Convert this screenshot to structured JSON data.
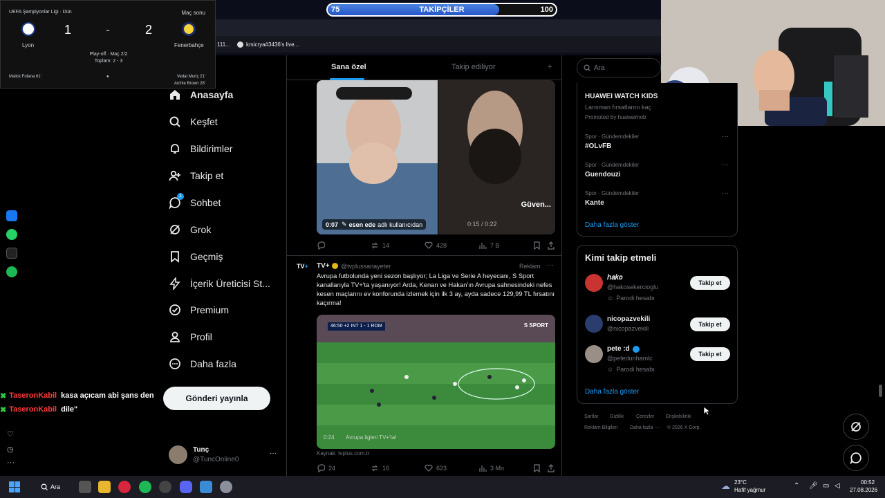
{
  "colors": {
    "accent": "#1d9bf0",
    "brand_red": "#e0245e",
    "bar_fill": "#2f66d6"
  },
  "stream": {
    "follower_bar": {
      "label": "TAKİPÇİLER",
      "current": "75",
      "goal": "100",
      "progress_fraction": 0.75
    },
    "scoreboard": {
      "competition": "UEFA Şampiyonlar Ligi · Dün",
      "status": "Maç sonu",
      "home_team": "Lyon",
      "away_team": "Fenerbahçe",
      "home_score": "1",
      "away_score": "2",
      "dash": "-",
      "round": "Play-off · Maç 2/2",
      "aggregate": "Toplam: 2 - 3",
      "home_scorer": "Malick Fofana 61'",
      "away_scorer_1": "Vedat Muriç 21'",
      "away_scorer_2": "Archie Brown 28'"
    },
    "browser_tabs": [
      "111...",
      "krsicrya#3436's live..."
    ],
    "chat": [
      {
        "user": "TaseronKabil",
        "message": "kasa açıcam abi şans den"
      },
      {
        "user": "TaseronKabil",
        "message": "dile\""
      }
    ]
  },
  "nav": {
    "items": [
      {
        "label": "Anasayfa",
        "icon": "home-icon"
      },
      {
        "label": "Keşfet",
        "icon": "search-icon"
      },
      {
        "label": "Bildirimler",
        "icon": "bell-icon"
      },
      {
        "label": "Takip et",
        "icon": "person-add-icon"
      },
      {
        "label": "Sohbet",
        "icon": "chat-icon",
        "badge": "1"
      },
      {
        "label": "Grok",
        "icon": "grok-icon"
      },
      {
        "label": "Geçmiş",
        "icon": "bookmark-icon"
      },
      {
        "label": "İçerik Üreticisi St...",
        "icon": "bolt-icon"
      },
      {
        "label": "Premium",
        "icon": "premium-icon"
      },
      {
        "label": "Profil",
        "icon": "person-icon"
      },
      {
        "label": "Daha fazla",
        "icon": "more-circle-icon"
      }
    ],
    "post_button": "Gönderi yayınla",
    "account": {
      "name": "Tunç",
      "handle": "@TuncOnline0",
      "more": "···"
    }
  },
  "feed": {
    "tabs": {
      "for_you": "Sana özel",
      "following": "Takip ediliyor",
      "add": "+"
    },
    "post1": {
      "video_time": "0:07",
      "caption_user": "esen ede",
      "caption_rest": "adlı kullanıcıdan",
      "video_time_right": "0:15 / 0:22",
      "overlay_text": "Güven...",
      "replies": "",
      "retweets": "14",
      "likes": "428",
      "views": "7 B"
    },
    "post2": {
      "author": "TV+",
      "handle": "@tvplussanayeter",
      "ad_label": "Reklam",
      "more": "···",
      "text": "Avrupa futbolunda yeni sezon başlıyor; La Liga ve Serie A heyecanı, S Sport kanallarıyla TV+'ta yaşanıyor! Arda, Kenan ve Hakan'ın Avrupa sahnesindeki nefes kesen maçlarını ev konforunda izlemek için ilk 3 ay, ayda sadece 129,99 TL fırsatını kaçırma!",
      "video_scoreboard": "46:50  +2  INT  1 - 1  ROM",
      "video_brand": "S SPORT",
      "video_time": "0:24",
      "video_caption": "Avrupa ligleri TV+'ta!",
      "source": "Kaynak: tvplus.com.tr",
      "replies": "24",
      "retweets": "16",
      "likes": "623",
      "views": "3 Mn"
    }
  },
  "right": {
    "search_placeholder": "Ara",
    "promo": {
      "title": "HUAWEI WATCH KIDS",
      "subtitle": "Lansman fırsatlarını kaç",
      "promoted": "Promoted by huaweimob"
    },
    "trends": [
      {
        "category": "Spor · Gündemdekiler",
        "name": "#OLvFB"
      },
      {
        "category": "Spor · Gündemdekiler",
        "name": "Guendouzi"
      },
      {
        "category": "Spor · Gündemdekiler",
        "name": "Kante"
      }
    ],
    "show_more": "Daha fazla göster",
    "who_to_follow": {
      "title": "Kimi takip etmeli",
      "users": [
        {
          "name": "ℎ𝑎𝑘𝑜",
          "handle": "@hakosekercioglu",
          "note": "Parodi hesabı",
          "button": "Takip et"
        },
        {
          "name": "nicopazvekili",
          "handle": "@nicopazvekili",
          "note": "",
          "button": "Takip et"
        },
        {
          "name": "pete :d",
          "handle": "@petedunhamlc",
          "note": "Parodi hesabı",
          "button": "Takip et"
        }
      ],
      "show_more": "Daha fazla göster"
    },
    "footer": [
      "Şartlar",
      "Gizlilik",
      "Çerezler",
      "Erişilebilirlik",
      "Reklam Bilgileri",
      "Daha fazla ···",
      "© 2026 X Corp."
    ]
  },
  "taskbar": {
    "search": "Ara",
    "temp": "23°C",
    "weather": "Hafif yağmur",
    "time": "00:52",
    "date": "27.08.2026"
  }
}
